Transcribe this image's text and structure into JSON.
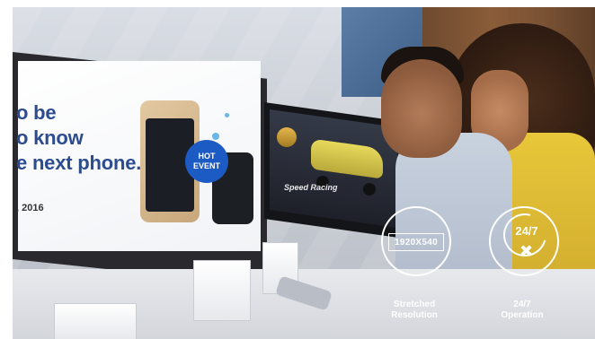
{
  "display_left": {
    "headline_lines": [
      "o be",
      "o know",
      "e next phone."
    ],
    "date": ", 2016",
    "badge_line1": "HOT",
    "badge_line2": "EVENT"
  },
  "display_mid": {
    "title": "Speed Racing"
  },
  "features": [
    {
      "icon": "resolution-badge-icon",
      "badge_text": "1920X540",
      "label_line1": "Stretched",
      "label_line2": "Resolution"
    },
    {
      "icon": "clock-tools-icon",
      "badge_text": "24/7",
      "label_line1": "24/7",
      "label_line2": "Operation"
    }
  ],
  "colors": {
    "headline": "#2d4c8f",
    "hot_badge": "#1d5bc4",
    "feature_text": "#ffffff"
  }
}
